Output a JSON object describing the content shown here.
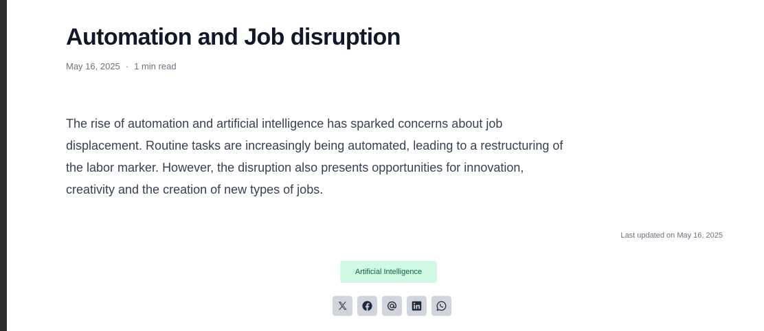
{
  "article": {
    "title": "Automation and Job disruption",
    "date": "May 16, 2025",
    "separator": "·",
    "read_time": "1 min read",
    "body": "The rise of automation and artificial intelligence has sparked concerns about job displacement. Routine tasks are increasingly being automated, leading to a restructuring of the labor marker. However, the disruption also presents opportunities for innovation, creativity and the creation of new types of jobs.",
    "last_updated": "Last updated on May 16, 2025"
  },
  "tags": [
    {
      "label": "Artificial Intelligence",
      "bg_color": "#d1fae5",
      "text_color": "#065f46"
    }
  ],
  "share": {
    "icons": [
      "x-icon",
      "facebook-icon",
      "threads-icon",
      "linkedin-icon",
      "whatsapp-icon"
    ]
  },
  "colors": {
    "title": "#111827",
    "body": "#374151",
    "muted": "#6b7280",
    "share_button_bg": "#d1d5db",
    "frame_dark": "#2b2b2b"
  }
}
